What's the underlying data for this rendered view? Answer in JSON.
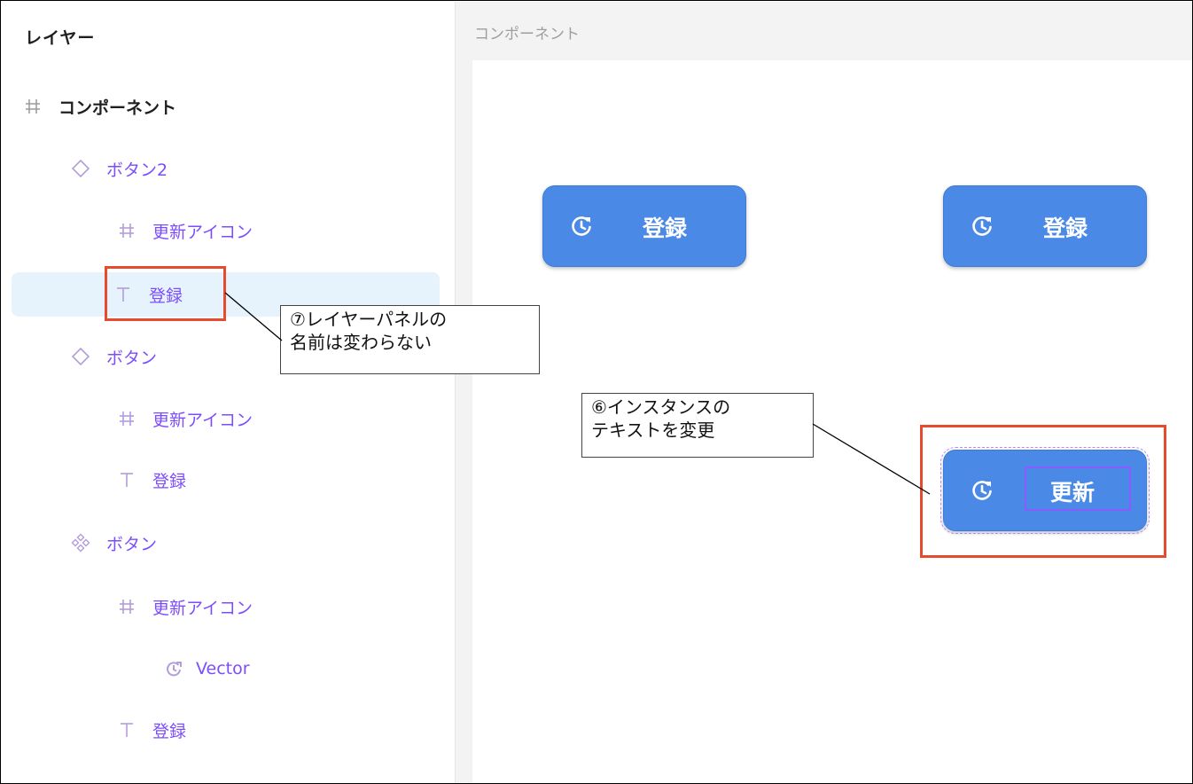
{
  "layers_panel": {
    "title": "レイヤー",
    "items": [
      {
        "label": "コンポーネント",
        "icon": "frame-icon"
      },
      {
        "label": "ボタン2",
        "icon": "component-instance-icon"
      },
      {
        "label": "更新アイコン",
        "icon": "frame-icon"
      },
      {
        "label": "登録",
        "icon": "text-icon"
      },
      {
        "label": "ボタン",
        "icon": "component-instance-icon"
      },
      {
        "label": "更新アイコン",
        "icon": "frame-icon"
      },
      {
        "label": "登録",
        "icon": "text-icon"
      },
      {
        "label": "ボタン",
        "icon": "main-component-icon"
      },
      {
        "label": "更新アイコン",
        "icon": "frame-icon"
      },
      {
        "label": "Vector",
        "icon": "vector-icon"
      },
      {
        "label": "登録",
        "icon": "text-icon"
      }
    ]
  },
  "canvas": {
    "frame_title": "コンポーネント",
    "buttons": [
      {
        "label": "登録",
        "icon": "refresh-clock-icon"
      },
      {
        "label": "登録",
        "icon": "refresh-clock-icon"
      },
      {
        "label": "更新",
        "icon": "refresh-clock-icon"
      }
    ]
  },
  "annotations": {
    "callout_7_line1": "⑦レイヤーパネルの",
    "callout_7_line2": "名前は変わらない",
    "callout_6_line1": "⑥インスタンスの",
    "callout_6_line2": "テキストを変更"
  },
  "colors": {
    "accent_purple": "#7c4dff",
    "button_blue": "#4a8ae6",
    "highlight_red": "#e54b2c",
    "selection_bg": "#e6f3fd"
  }
}
